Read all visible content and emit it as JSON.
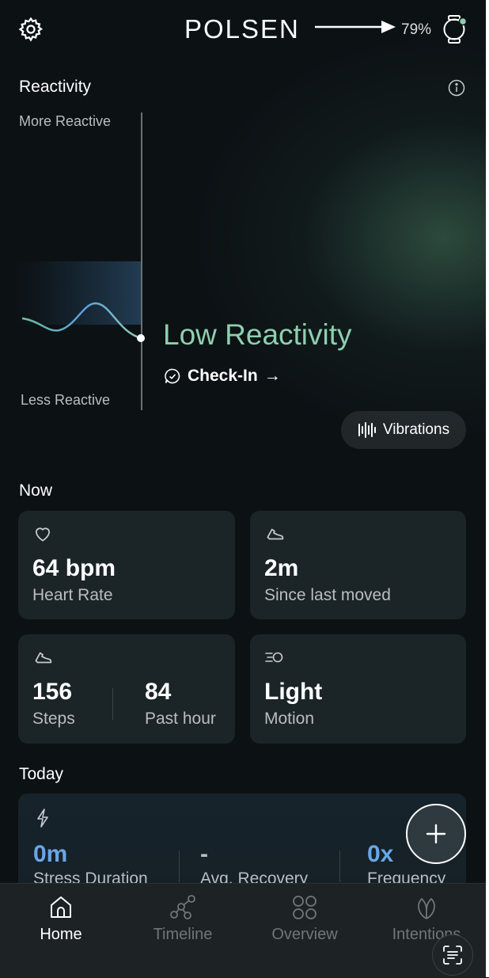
{
  "header": {
    "brand": "POLSEN",
    "battery": "79%"
  },
  "reactivity": {
    "title": "Reactivity",
    "top_label": "More Reactive",
    "bottom_label": "Less Reactive",
    "status": "Low Reactivity",
    "checkin_label": "Check-In",
    "checkin_arrow": "→",
    "vibrations_label": "Vibrations"
  },
  "now": {
    "title": "Now",
    "heart": {
      "value": "64 bpm",
      "label": "Heart Rate"
    },
    "moved": {
      "value": "2m",
      "label": "Since last moved"
    },
    "steps": {
      "value": "156",
      "label": "Steps",
      "hour_value": "84",
      "hour_label": "Past hour"
    },
    "motion": {
      "value": "Light",
      "label": "Motion"
    }
  },
  "today": {
    "title": "Today",
    "stress": {
      "value": "0m",
      "label": "Stress Duration"
    },
    "recovery": {
      "value": "-",
      "label": "Avg. Recovery"
    },
    "frequency": {
      "value": "0x",
      "label": "Frequency"
    }
  },
  "nav": {
    "items": [
      {
        "label": "Home",
        "icon": "home-icon",
        "active": true
      },
      {
        "label": "Timeline",
        "icon": "timeline-icon",
        "active": false
      },
      {
        "label": "Overview",
        "icon": "overview-icon",
        "active": false
      },
      {
        "label": "Intentions",
        "icon": "leaf-icon",
        "active": false
      }
    ]
  },
  "colors": {
    "accent_green": "#8fcfae",
    "accent_blue": "#6aa6e6",
    "card": "#1b2426",
    "background": "#0c1114"
  }
}
